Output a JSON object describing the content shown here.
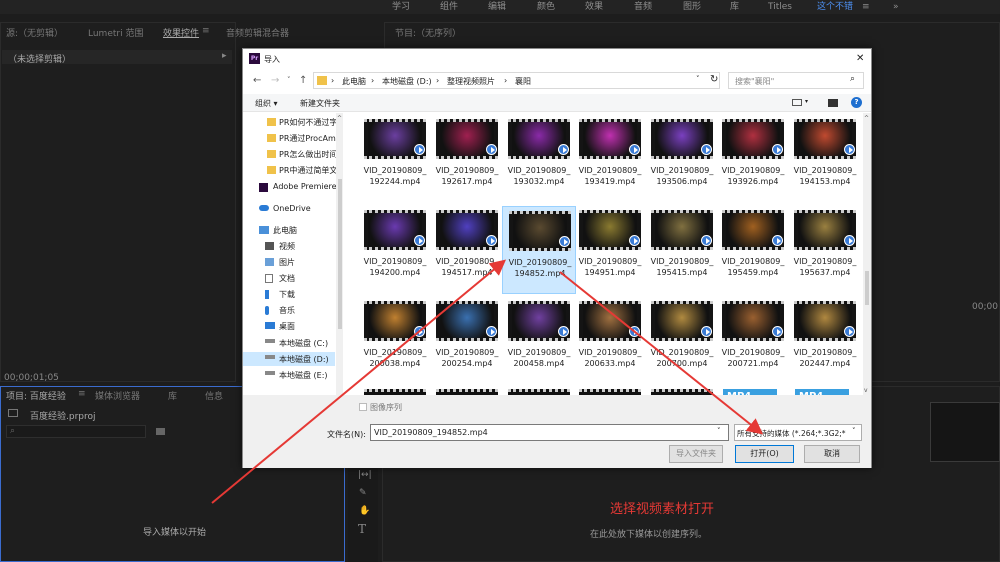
{
  "workspace_tabs": [
    "学习",
    "组件",
    "编辑",
    "颜色",
    "效果",
    "音频",
    "图形",
    "库",
    "Titles",
    "这个不错"
  ],
  "workspace_more": "≡",
  "workspace_arrow": "»",
  "source_panel": {
    "tabs": [
      "源:（无剪辑）",
      "Lumetri 范围",
      "效果控件",
      "音频剪辑混合器"
    ],
    "menu": "≡",
    "subtitle": "（未选择剪辑）",
    "timecode": "00;00;01;05"
  },
  "program_panel": {
    "title": "节目:（无序列）",
    "menu": "≡",
    "timecode_right": "00;00"
  },
  "project_panel": {
    "tabs": [
      "项目: 百度经验",
      "媒体浏览器",
      "库",
      "信息"
    ],
    "menu": "≡",
    "project_file": "百度经验.prproj",
    "empty_text": "导入媒体以开始"
  },
  "timeline_panel": {
    "empty_text": "在此处放下媒体以创建序列。"
  },
  "annotation": {
    "text": "选择视频素材打开",
    "color": "#e53935"
  },
  "dialog": {
    "title": "导入",
    "app_icon_text": "Pr",
    "close_glyph": "✕",
    "breadcrumb": [
      "此电脑",
      "本地磁盘 (D:)",
      "整理视频照片",
      "襄阳"
    ],
    "search_placeholder": "搜索\"襄阳\"",
    "organize": "组织 ▾",
    "new_folder": "新建文件夹",
    "nav": [
      {
        "label": "PR如何不通过字",
        "icon": "folder"
      },
      {
        "label": "PR通过ProcAmp",
        "icon": "folder"
      },
      {
        "label": "PR怎么做出时间",
        "icon": "folder"
      },
      {
        "label": "PR中通过简单文",
        "icon": "folder"
      },
      {
        "label": "Adobe Premiere",
        "icon": "premiere"
      },
      {
        "label": "OneDrive",
        "icon": "cloud"
      },
      {
        "label": "此电脑",
        "icon": "pc"
      },
      {
        "label": "视频",
        "icon": "video"
      },
      {
        "label": "图片",
        "icon": "picture"
      },
      {
        "label": "文档",
        "icon": "doc"
      },
      {
        "label": "下载",
        "icon": "download"
      },
      {
        "label": "音乐",
        "icon": "music"
      },
      {
        "label": "桌面",
        "icon": "desktop"
      },
      {
        "label": "本地磁盘 (C:)",
        "icon": "drive"
      },
      {
        "label": "本地磁盘 (D:)",
        "icon": "drive"
      },
      {
        "label": "本地磁盘 (E:)",
        "icon": "drive"
      }
    ],
    "files": [
      {
        "name": "VID_20190809_ 192244.mp4",
        "tint": "#6b3fa0"
      },
      {
        "name": "VID_20190809_ 192617.mp4",
        "tint": "#a02050"
      },
      {
        "name": "VID_20190809_ 193032.mp4",
        "tint": "#8a2aa8"
      },
      {
        "name": "VID_20190809_ 193419.mp4",
        "tint": "#c030b0"
      },
      {
        "name": "VID_20190809_ 193506.mp4",
        "tint": "#7a40c0"
      },
      {
        "name": "VID_20190809_ 193926.mp4",
        "tint": "#b03040"
      },
      {
        "name": "VID_20190809_ 194153.mp4",
        "tint": "#c04a30"
      },
      {
        "name": "VID_20190809_ 194200.mp4",
        "tint": "#6a3ab0"
      },
      {
        "name": "VID_20190809_ 194517.mp4",
        "tint": "#5040c0"
      },
      {
        "name": "VID_20190809_ 194852.mp4",
        "tint": "#5a4a30",
        "selected": true
      },
      {
        "name": "VID_20190809_ 194951.mp4",
        "tint": "#8a7a30"
      },
      {
        "name": "VID_20190809_ 195415.mp4",
        "tint": "#807040"
      },
      {
        "name": "VID_20190809_ 195459.mp4",
        "tint": "#a06020"
      },
      {
        "name": "VID_20190809_ 195637.mp4",
        "tint": "#9a8040"
      },
      {
        "name": "VID_20190809_ 200038.mp4",
        "tint": "#c08030"
      },
      {
        "name": "VID_20190809_ 200254.mp4",
        "tint": "#3a70b0"
      },
      {
        "name": "VID_20190809_ 200458.mp4",
        "tint": "#7040a0"
      },
      {
        "name": "VID_20190809_ 200633.mp4",
        "tint": "#a07040"
      },
      {
        "name": "VID_20190809_ 200700.mp4",
        "tint": "#b08a40"
      },
      {
        "name": "VID_20190809_ 200721.mp4",
        "tint": "#9a6030"
      },
      {
        "name": "VID_20190809_ 202447.mp4",
        "tint": "#b08840"
      }
    ],
    "mp4_label": "MP4",
    "image_sequence": "图像序列",
    "filename_label": "文件名(N):",
    "filename_value": "VID_20190809_194852.mp4",
    "filetype_value": "所有支持的媒体 (*.264;*.3G2;*",
    "import_folder": "导入文件夹",
    "open": "打开(O)",
    "cancel": "取消"
  }
}
